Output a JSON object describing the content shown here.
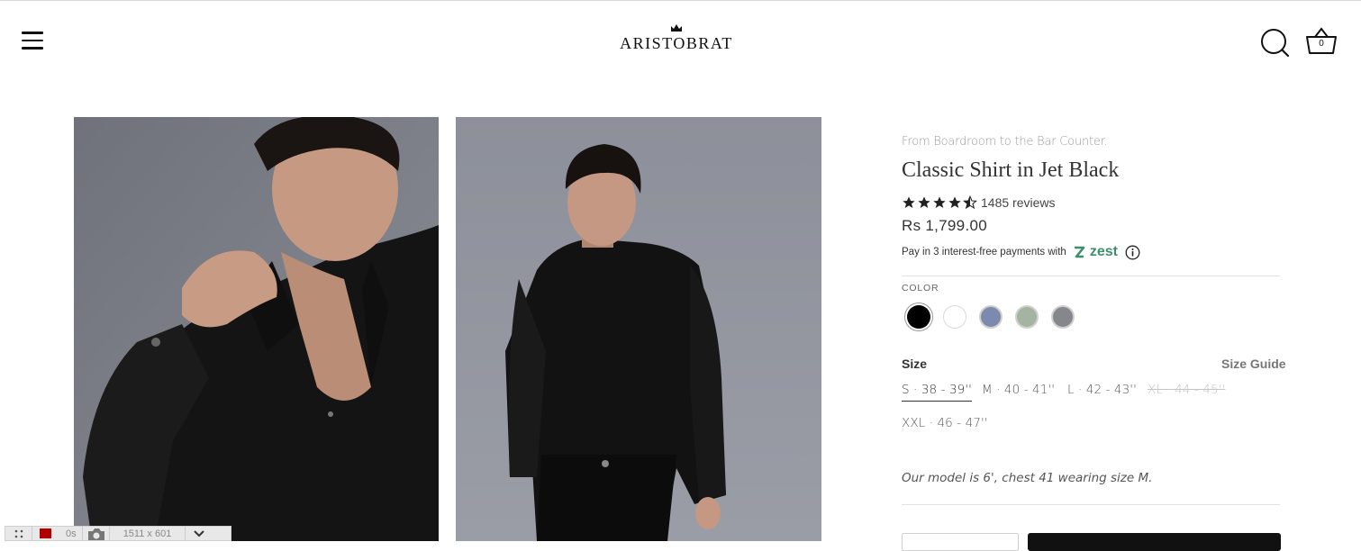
{
  "header": {
    "brand": "ARISTOBRAT",
    "cart_count": "0"
  },
  "product": {
    "tagline": "From Boardroom to the Bar Counter.",
    "title": "Classic Shirt in Jet Black",
    "rating": 4.5,
    "reviews_label": "1485 reviews",
    "price": "Rs 1,799.00",
    "pay_text": "Pay in 3 interest-free payments with",
    "pay_brand": "zest",
    "color_label": "COLOR",
    "colors": [
      {
        "hex": "#000000",
        "selected": true
      },
      {
        "hex": "#ffffff",
        "selected": false
      },
      {
        "hex": "#7c8bad",
        "selected": false
      },
      {
        "hex": "#a5b4a0",
        "selected": false
      },
      {
        "hex": "#86878c",
        "selected": false
      }
    ],
    "size_label": "Size",
    "size_guide": "Size Guide",
    "sizes": [
      {
        "label": "S · 38 - 39''",
        "state": "selected"
      },
      {
        "label": "M · 40 - 41''",
        "state": "available"
      },
      {
        "label": "L · 42 - 43''",
        "state": "available"
      },
      {
        "label": "XL · 44 - 45''",
        "state": "sold-out"
      },
      {
        "label": "XXL · 46 - 47''",
        "state": "available"
      }
    ],
    "model_note": "Our model is 6', chest 41 wearing size M."
  },
  "devbar": {
    "timer": "0s",
    "dimensions": "1511 x 601"
  },
  "colors": {
    "accent_zest": "#3e8e6a",
    "photo_background": "#7d8088",
    "record": "#b10000"
  }
}
